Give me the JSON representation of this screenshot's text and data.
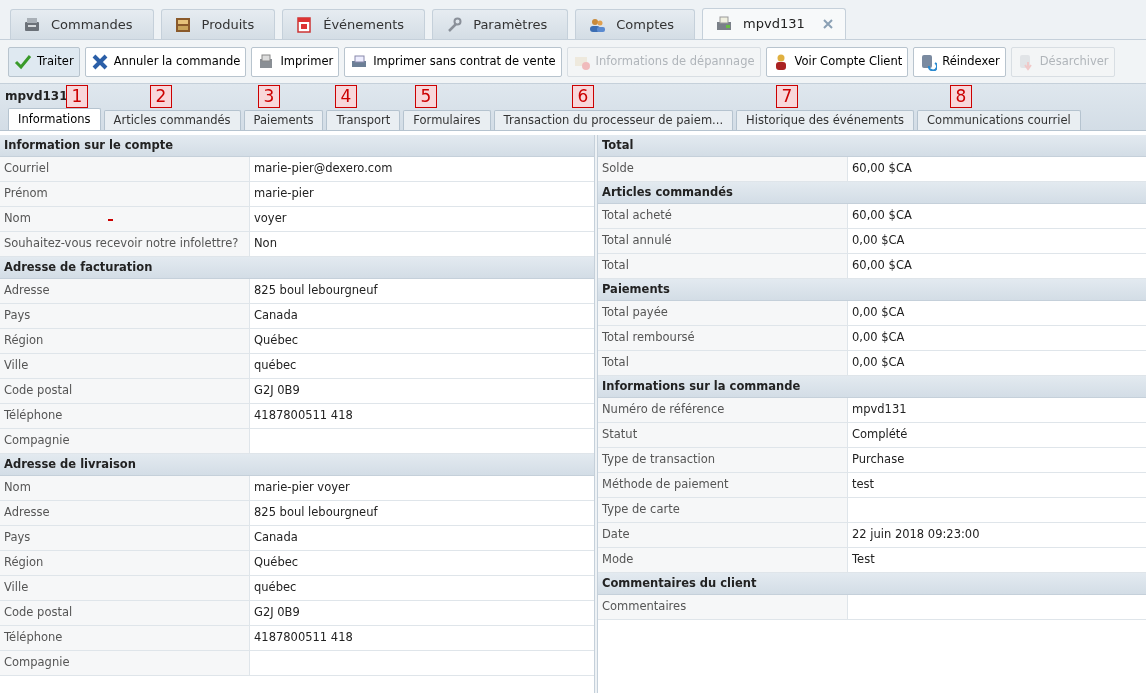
{
  "main_tabs": [
    {
      "label": "Commandes",
      "selected": false,
      "closable": false
    },
    {
      "label": "Produits",
      "selected": false,
      "closable": false
    },
    {
      "label": "Événements",
      "selected": false,
      "closable": false
    },
    {
      "label": "Paramètres",
      "selected": false,
      "closable": false
    },
    {
      "label": "Comptes",
      "selected": false,
      "closable": false
    },
    {
      "label": "mpvd131",
      "selected": true,
      "closable": true
    }
  ],
  "toolbar": [
    {
      "label": "Traiter",
      "disabled": false,
      "pressed": true
    },
    {
      "label": "Annuler la commande",
      "disabled": false,
      "pressed": false
    },
    {
      "label": "Imprimer",
      "disabled": false,
      "pressed": false
    },
    {
      "label": "Imprimer sans contrat de vente",
      "disabled": false,
      "pressed": false
    },
    {
      "label": "Informations de dépannage",
      "disabled": true,
      "pressed": false
    },
    {
      "label": "Voir Compte Client",
      "disabled": false,
      "pressed": false
    },
    {
      "label": "Réindexer",
      "disabled": false,
      "pressed": false
    },
    {
      "label": "Désarchiver",
      "disabled": true,
      "pressed": false
    }
  ],
  "title": "mpvd131",
  "annotations": [
    "1",
    "2",
    "3",
    "4",
    "5",
    "6",
    "7",
    "8"
  ],
  "sub_tabs": [
    {
      "label": "Informations",
      "selected": true
    },
    {
      "label": "Articles commandés",
      "selected": false
    },
    {
      "label": "Paiements",
      "selected": false
    },
    {
      "label": "Transport",
      "selected": false
    },
    {
      "label": "Formulaires",
      "selected": false
    },
    {
      "label": "Transaction du processeur de paiem...",
      "selected": false
    },
    {
      "label": "Historique des événements",
      "selected": false
    },
    {
      "label": "Communications courriel",
      "selected": false
    }
  ],
  "left_sections": [
    {
      "title": "Information sur le compte",
      "rows": [
        {
          "label": "Courriel",
          "value": "marie-pier@dexero.com",
          "flagged": false
        },
        {
          "label": "Prénom",
          "value": "marie-pier",
          "flagged": false
        },
        {
          "label": "Nom",
          "value": "voyer",
          "flagged": true
        },
        {
          "label": "Souhaitez-vous recevoir notre infolettre?",
          "value": "Non",
          "flagged": false
        }
      ]
    },
    {
      "title": "Adresse de facturation",
      "rows": [
        {
          "label": "Adresse",
          "value": "825 boul lebourgneuf",
          "flagged": false
        },
        {
          "label": "Pays",
          "value": "Canada",
          "flagged": false
        },
        {
          "label": "Région",
          "value": "Québec",
          "flagged": false
        },
        {
          "label": "Ville",
          "value": "québec",
          "flagged": false
        },
        {
          "label": "Code postal",
          "value": "G2J 0B9",
          "flagged": false
        },
        {
          "label": "Téléphone",
          "value": "4187800511 418",
          "flagged": false
        },
        {
          "label": "Compagnie",
          "flagged": false
        }
      ]
    },
    {
      "title": "Adresse de livraison",
      "rows": [
        {
          "label": "Nom",
          "value": "marie-pier voyer",
          "flagged": false
        },
        {
          "label": "Adresse",
          "value": "825 boul lebourgneuf",
          "flagged": false
        },
        {
          "label": "Pays",
          "value": "Canada",
          "flagged": false
        },
        {
          "label": "Région",
          "value": "Québec",
          "flagged": false
        },
        {
          "label": "Ville",
          "value": "québec",
          "flagged": false
        },
        {
          "label": "Code postal",
          "value": "G2J 0B9",
          "flagged": false
        },
        {
          "label": "Téléphone",
          "value": "4187800511 418",
          "flagged": false
        },
        {
          "label": "Compagnie",
          "flagged": false
        }
      ]
    }
  ],
  "right_sections": [
    {
      "title": "Total",
      "rows": [
        {
          "label": "Solde",
          "value": "60,00 $CA"
        }
      ]
    },
    {
      "title": "Articles commandés",
      "rows": [
        {
          "label": "Total acheté",
          "value": "60,00 $CA"
        },
        {
          "label": "Total annulé",
          "value": "0,00 $CA"
        },
        {
          "label": "Total",
          "value": "60,00 $CA"
        }
      ]
    },
    {
      "title": "Paiements",
      "rows": [
        {
          "label": "Total payée",
          "value": "0,00 $CA"
        },
        {
          "label": "Total remboursé",
          "value": "0,00 $CA"
        },
        {
          "label": "Total",
          "value": "0,00 $CA"
        }
      ]
    },
    {
      "title": "Informations sur la commande",
      "rows": [
        {
          "label": "Numéro de référence",
          "value": "mpvd131"
        },
        {
          "label": "Statut",
          "value": "Complété"
        },
        {
          "label": "Type de transaction",
          "value": "Purchase"
        },
        {
          "label": "Méthode de paiement",
          "value": "test"
        },
        {
          "label": "Type de carte"
        },
        {
          "label": "Date",
          "value": "22 juin 2018 09:23:00"
        },
        {
          "label": "Mode",
          "value": "Test"
        }
      ]
    },
    {
      "title": "Commentaires du client",
      "rows": [
        {
          "label": "Commentaires"
        }
      ]
    }
  ]
}
